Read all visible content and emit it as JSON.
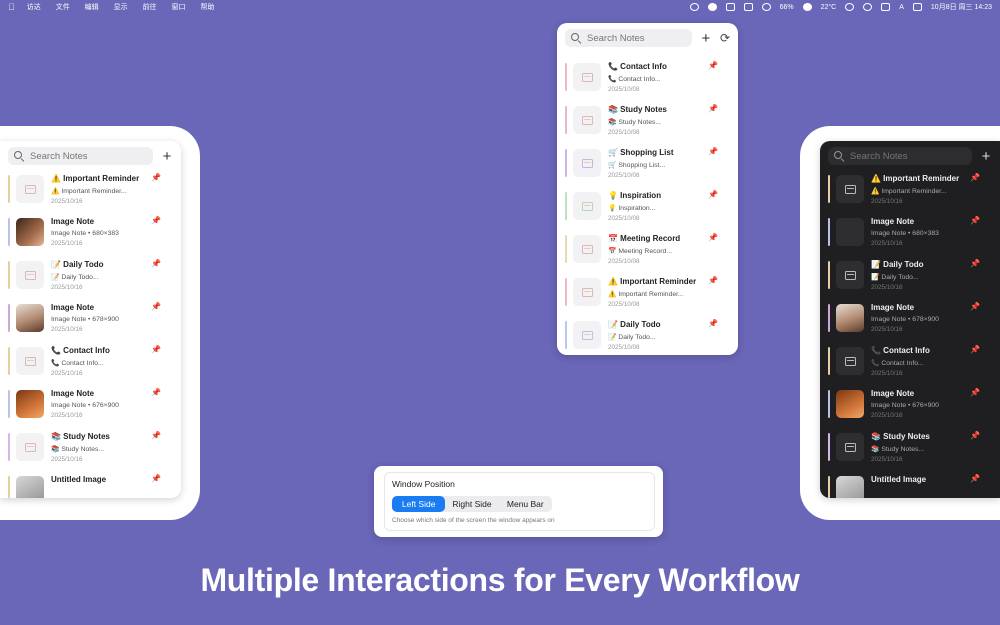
{
  "menubar": {
    "apple": "",
    "menus": [
      "访达",
      "文件",
      "编辑",
      "显示",
      "前往",
      "窗口",
      "帮助"
    ],
    "battery": "66%",
    "weather": "22°C",
    "datetime": "10月8日 周三  14:23",
    "input": "A"
  },
  "panel_left": {
    "search_placeholder": "Search Notes",
    "add_label": "+",
    "notes": [
      {
        "title": "⚠️ Important Reminder",
        "sub": "⚠️ Important Reminder...",
        "date": "2025/10/16"
      },
      {
        "title": "Image Note",
        "sub": "Image Note • 680×383",
        "date": "2025/10/16"
      },
      {
        "title": "📝 Daily Todo",
        "sub": "📝 Daily Todo...",
        "date": "2025/10/16"
      },
      {
        "title": "Image Note",
        "sub": "Image Note • 678×900",
        "date": "2025/10/16"
      },
      {
        "title": "📞 Contact Info",
        "sub": "📞 Contact Info...",
        "date": "2025/10/16"
      },
      {
        "title": "Image Note",
        "sub": "Image Note • 676×900",
        "date": "2025/10/16"
      },
      {
        "title": "📚 Study Notes",
        "sub": "📚 Study Notes...",
        "date": "2025/10/16"
      },
      {
        "title": "Untitled Image",
        "sub": "",
        "date": ""
      }
    ]
  },
  "panel_center": {
    "search_placeholder": "Search Notes",
    "add_label": "+",
    "sync_label": "⟳",
    "notes": [
      {
        "title": "📞 Contact Info",
        "sub": "📞 Contact Info...",
        "date": "2025/10/08"
      },
      {
        "title": "📚 Study Notes",
        "sub": "📚 Study Notes...",
        "date": "2025/10/08"
      },
      {
        "title": "🛒 Shopping List",
        "sub": "🛒 Shopping List...",
        "date": "2025/10/08"
      },
      {
        "title": "💡 Inspiration",
        "sub": "💡 Inspiration...",
        "date": "2025/10/08"
      },
      {
        "title": "📅 Meeting Record",
        "sub": "📅 Meeting Record...",
        "date": "2025/10/08"
      },
      {
        "title": "⚠️ Important Reminder",
        "sub": "⚠️ Important Reminder...",
        "date": "2025/10/08"
      },
      {
        "title": "📝 Daily Todo",
        "sub": "📝 Daily Todo...",
        "date": "2025/10/08"
      }
    ]
  },
  "panel_right": {
    "search_placeholder": "Search Notes",
    "add_label": "+",
    "notes": [
      {
        "title": "⚠️ Important Reminder",
        "sub": "⚠️ Important Reminder...",
        "date": "2025/10/16"
      },
      {
        "title": "Image Note",
        "sub": "Image Note • 680×383",
        "date": "2025/10/16"
      },
      {
        "title": "📝 Daily Todo",
        "sub": "📝 Daily Todo...",
        "date": "2025/10/16"
      },
      {
        "title": "Image Note",
        "sub": "Image Note • 678×900",
        "date": "2025/10/16"
      },
      {
        "title": "📞 Contact Info",
        "sub": "📞 Contact Info...",
        "date": "2025/10/16"
      },
      {
        "title": "Image Note",
        "sub": "Image Note • 676×900",
        "date": "2025/10/16"
      },
      {
        "title": "📚 Study Notes",
        "sub": "📚 Study Notes...",
        "date": "2025/10/16"
      },
      {
        "title": "Untitled Image",
        "sub": "",
        "date": ""
      }
    ]
  },
  "settings": {
    "title": "Window Position",
    "options": [
      "Left Side",
      "Right Side",
      "Menu Bar"
    ],
    "selected": "Left Side",
    "hint": "Choose which side of the screen the window appears on"
  },
  "tagline": "Multiple Interactions for Every Workflow",
  "colors": {
    "background": "#6a66b8",
    "accent_blue": "#1a7cf2",
    "pin": "#f5a623",
    "dark_panel": "#1f1f21"
  },
  "icons": {
    "search": "search-icon",
    "add": "plus-icon",
    "sync": "sync-icon",
    "pin": "pin-icon",
    "note": "note-icon"
  }
}
